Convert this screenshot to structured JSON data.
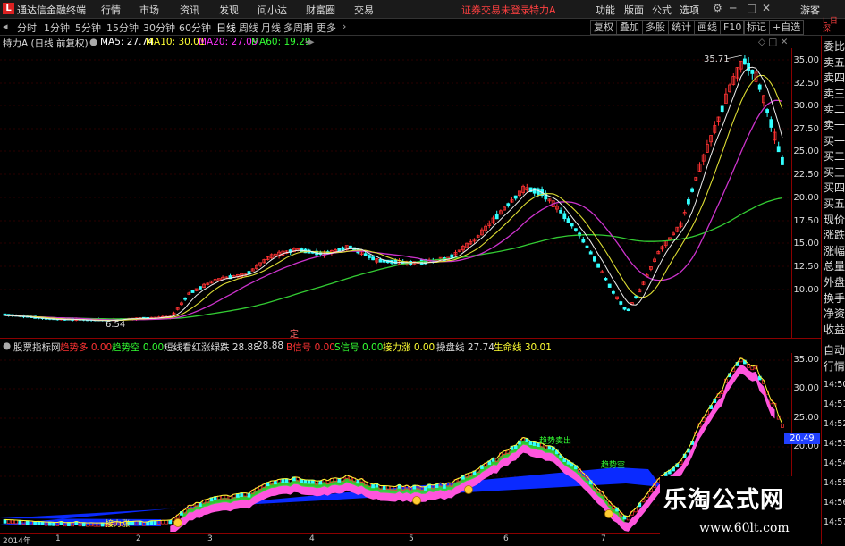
{
  "titlebar": {
    "logo": "L",
    "app_title": "通达信金融终端",
    "menus": [
      "行情",
      "市场",
      "资讯",
      "发现",
      "问小达",
      "财富圈",
      "交易"
    ],
    "warning": "证券交易未登录",
    "stock_title": "特力A",
    "right_menus": [
      "功能",
      "版面",
      "公式",
      "选项"
    ],
    "user": "游客"
  },
  "toolbar": {
    "periods": [
      "分时",
      "1分钟",
      "5分钟",
      "15分钟",
      "30分钟",
      "60分钟",
      "日线",
      "周线",
      "月线",
      "多周期",
      "更多"
    ],
    "active_period": "日线",
    "right_buttons": [
      "复权",
      "叠加",
      "多股",
      "统计",
      "画线",
      "F10",
      "标记",
      "+自选"
    ],
    "corner": "L 日 深"
  },
  "infobar": {
    "stock": "特力A (日线 前复权)",
    "ma5": "MA5: 27.74",
    "ma10": "MA10: 30.01",
    "ma20": "MA20: 27.09",
    "ma60": "MA60: 19.29"
  },
  "main_chart": {
    "y_ticks": [
      "35.00",
      "32.50",
      "30.00",
      "27.50",
      "25.00",
      "22.50",
      "20.00",
      "17.50",
      "15.00",
      "12.50",
      "10.00"
    ],
    "high_label": "35.71",
    "low_label": "6.54",
    "marker": "定"
  },
  "sub_info": {
    "name": "股票指标网",
    "items": [
      {
        "label": "趋势多",
        "value": "0.00",
        "color": "#ff3333"
      },
      {
        "label": "趋势空",
        "value": "0.00",
        "color": "#33ff33"
      },
      {
        "label": "短线看红涨绿跌",
        "value": "28.88",
        "color": "#dddddd"
      },
      {
        "label": "",
        "value": "28.88",
        "color": "#dddddd"
      },
      {
        "label": "B信号",
        "value": "0.00",
        "color": "#ff3333"
      },
      {
        "label": "S信号",
        "value": "0.00",
        "color": "#33ff33"
      },
      {
        "label": "接力涨",
        "value": "0.00",
        "color": "#ffff33"
      },
      {
        "label": "操盘线",
        "value": "27.74",
        "color": "#dddddd"
      },
      {
        "label": "生命线",
        "value": "30.01",
        "color": "#ffff33"
      }
    ]
  },
  "sub_chart": {
    "y_ticks": [
      "35.00",
      "30.00",
      "25.00",
      "20.00"
    ],
    "current_value": "20.49",
    "annotations": [
      "趋势空",
      "接力涨",
      "趋势卖出"
    ],
    "time_labels": [
      "14:50",
      "14:51",
      "14:52",
      "14:53",
      "14:54",
      "14:55",
      "14:56",
      "14:57"
    ]
  },
  "right_panel": [
    "委比",
    "卖五",
    "卖四",
    "卖三",
    "卖二",
    "卖一",
    "买一",
    "买二",
    "买三",
    "买四",
    "买五",
    "现价",
    "涨跌",
    "涨幅",
    "总量",
    "外盘",
    "换手",
    "净资",
    "收益",
    "自动",
    "行情"
  ],
  "date_axis": [
    "2014年",
    "1",
    "2",
    "3",
    "4",
    "5",
    "6",
    "7"
  ],
  "watermark": {
    "title": "乐淘公式网",
    "url": "www.60lt.com"
  },
  "colors": {
    "ma5": "#ffffff",
    "ma10": "#ffff33",
    "ma20": "#ff33ff",
    "ma60": "#33ff33",
    "up": "#ff3333",
    "down": "#33ffff",
    "border": "#8b0000"
  }
}
